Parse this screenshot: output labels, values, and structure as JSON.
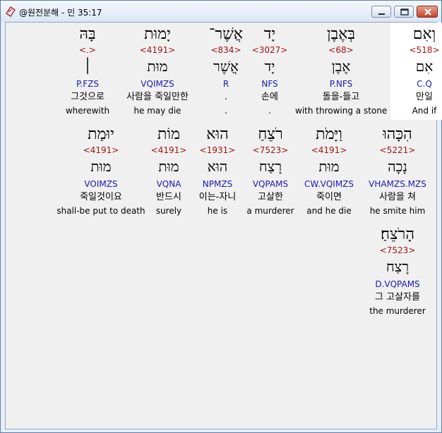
{
  "window": {
    "title": "@원전분해 - 민 35:17",
    "icon": "app-bible-icon",
    "controls": [
      "minimize-icon",
      "maximize-icon",
      "close-icon"
    ],
    "colors": {
      "title_bg": "#dbe6f4",
      "client_bg": "#f0f0f0",
      "highlight_bg": "#ffffff",
      "strong_color": "#a01414",
      "parse_color": "#1a1ab4",
      "close_bg": "#c8432c"
    }
  },
  "rows": [
    {
      "words": [
        {
          "hebrew": "וְאִם",
          "strong": "<518>",
          "root": "אִם",
          "parse": "C.Q",
          "korean": "만일",
          "english": "And if",
          "highlighted": true
        },
        {
          "hebrew": "בְּאֶבֶן",
          "strong": "<68>",
          "root": "אֶבֶן",
          "parse": "P.NFS",
          "korean": "돌을-들고",
          "english": "with throwing a stone",
          "highlighted": false
        },
        {
          "hebrew": "יָד",
          "strong": "<3027>",
          "root": "יָד",
          "parse": "NFS",
          "korean": "손에",
          "english": ".",
          "highlighted": false
        },
        {
          "hebrew": "אֲשֶׁר־",
          "strong": "<834>",
          "root": "אֲשֶׁר",
          "parse": "R",
          "korean": ".",
          "english": ".",
          "highlighted": false
        },
        {
          "hebrew": "יָמוּת",
          "strong": "<4191>",
          "root": "מוּת",
          "parse": "VQIMZS",
          "korean": "사람을 죽일만한",
          "english": "he may die",
          "highlighted": false
        },
        {
          "hebrew": "בָּהּ",
          "strong": "<.>",
          "root": "׀",
          "parse": "P.FZS",
          "korean": "그것으로",
          "english": "wherewith",
          "highlighted": false
        }
      ]
    },
    {
      "words": [
        {
          "hebrew": "הִכָּהוּ",
          "strong": "<5221>",
          "root": "נָכָה",
          "parse": "VHAMZS.MZS",
          "korean": "사람을 쳐",
          "english": "he smite him",
          "highlighted": false
        },
        {
          "hebrew": "וַיָּמֹת",
          "strong": "<4191>",
          "root": "מוּת",
          "parse": "CW.VQIMZS",
          "korean": "죽이면",
          "english": "and he die",
          "highlighted": false
        },
        {
          "hebrew": "רֹצֵחַ",
          "strong": "<7523>",
          "root": "רָצַח",
          "parse": "VQPAMS",
          "korean": "고살한",
          "english": "a murderer",
          "highlighted": false
        },
        {
          "hebrew": "הוּא",
          "strong": "<1931>",
          "root": "הוּא",
          "parse": "NPMZS",
          "korean": "이는-자니",
          "english": "he is",
          "highlighted": false
        },
        {
          "hebrew": "מוֹת",
          "strong": "<4191>",
          "root": "מוּת",
          "parse": "VQNA",
          "korean": "반드시",
          "english": "surely",
          "highlighted": false
        },
        {
          "hebrew": "יוּמַת",
          "strong": "<4191>",
          "root": "מוּת",
          "parse": "VOIMZS",
          "korean": "죽일것이요",
          "english": "shall-be put to death",
          "highlighted": false
        }
      ]
    },
    {
      "words": [
        {
          "hebrew": "הָרֹצֵחַ׃",
          "strong": "<7523>",
          "root": "רָצַח",
          "parse": "D.VQPAMS",
          "korean": "그 고살자를",
          "english": "the murderer",
          "highlighted": false
        }
      ]
    }
  ]
}
